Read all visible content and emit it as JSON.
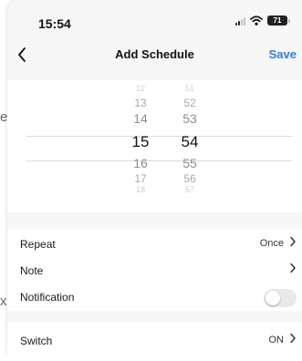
{
  "status_bar": {
    "time": "15:54",
    "battery": "71"
  },
  "nav": {
    "title": "Add Schedule",
    "save_label": "Save"
  },
  "picker": {
    "hours": [
      "12",
      "13",
      "14",
      "15",
      "16",
      "17",
      "18"
    ],
    "minutes": [
      "51",
      "52",
      "53",
      "54",
      "55",
      "56",
      "57"
    ],
    "selected_hour": "15",
    "selected_minute": "54"
  },
  "settings": {
    "repeat": {
      "label": "Repeat",
      "value": "Once"
    },
    "note": {
      "label": "Note"
    },
    "notification": {
      "label": "Notification",
      "enabled": false
    }
  },
  "switch": {
    "label": "Switch",
    "value": "ON"
  },
  "colors": {
    "accent": "#2f7de1",
    "sheet_background": "#f7f7f7",
    "toggle_off": "#e9e9ea"
  }
}
